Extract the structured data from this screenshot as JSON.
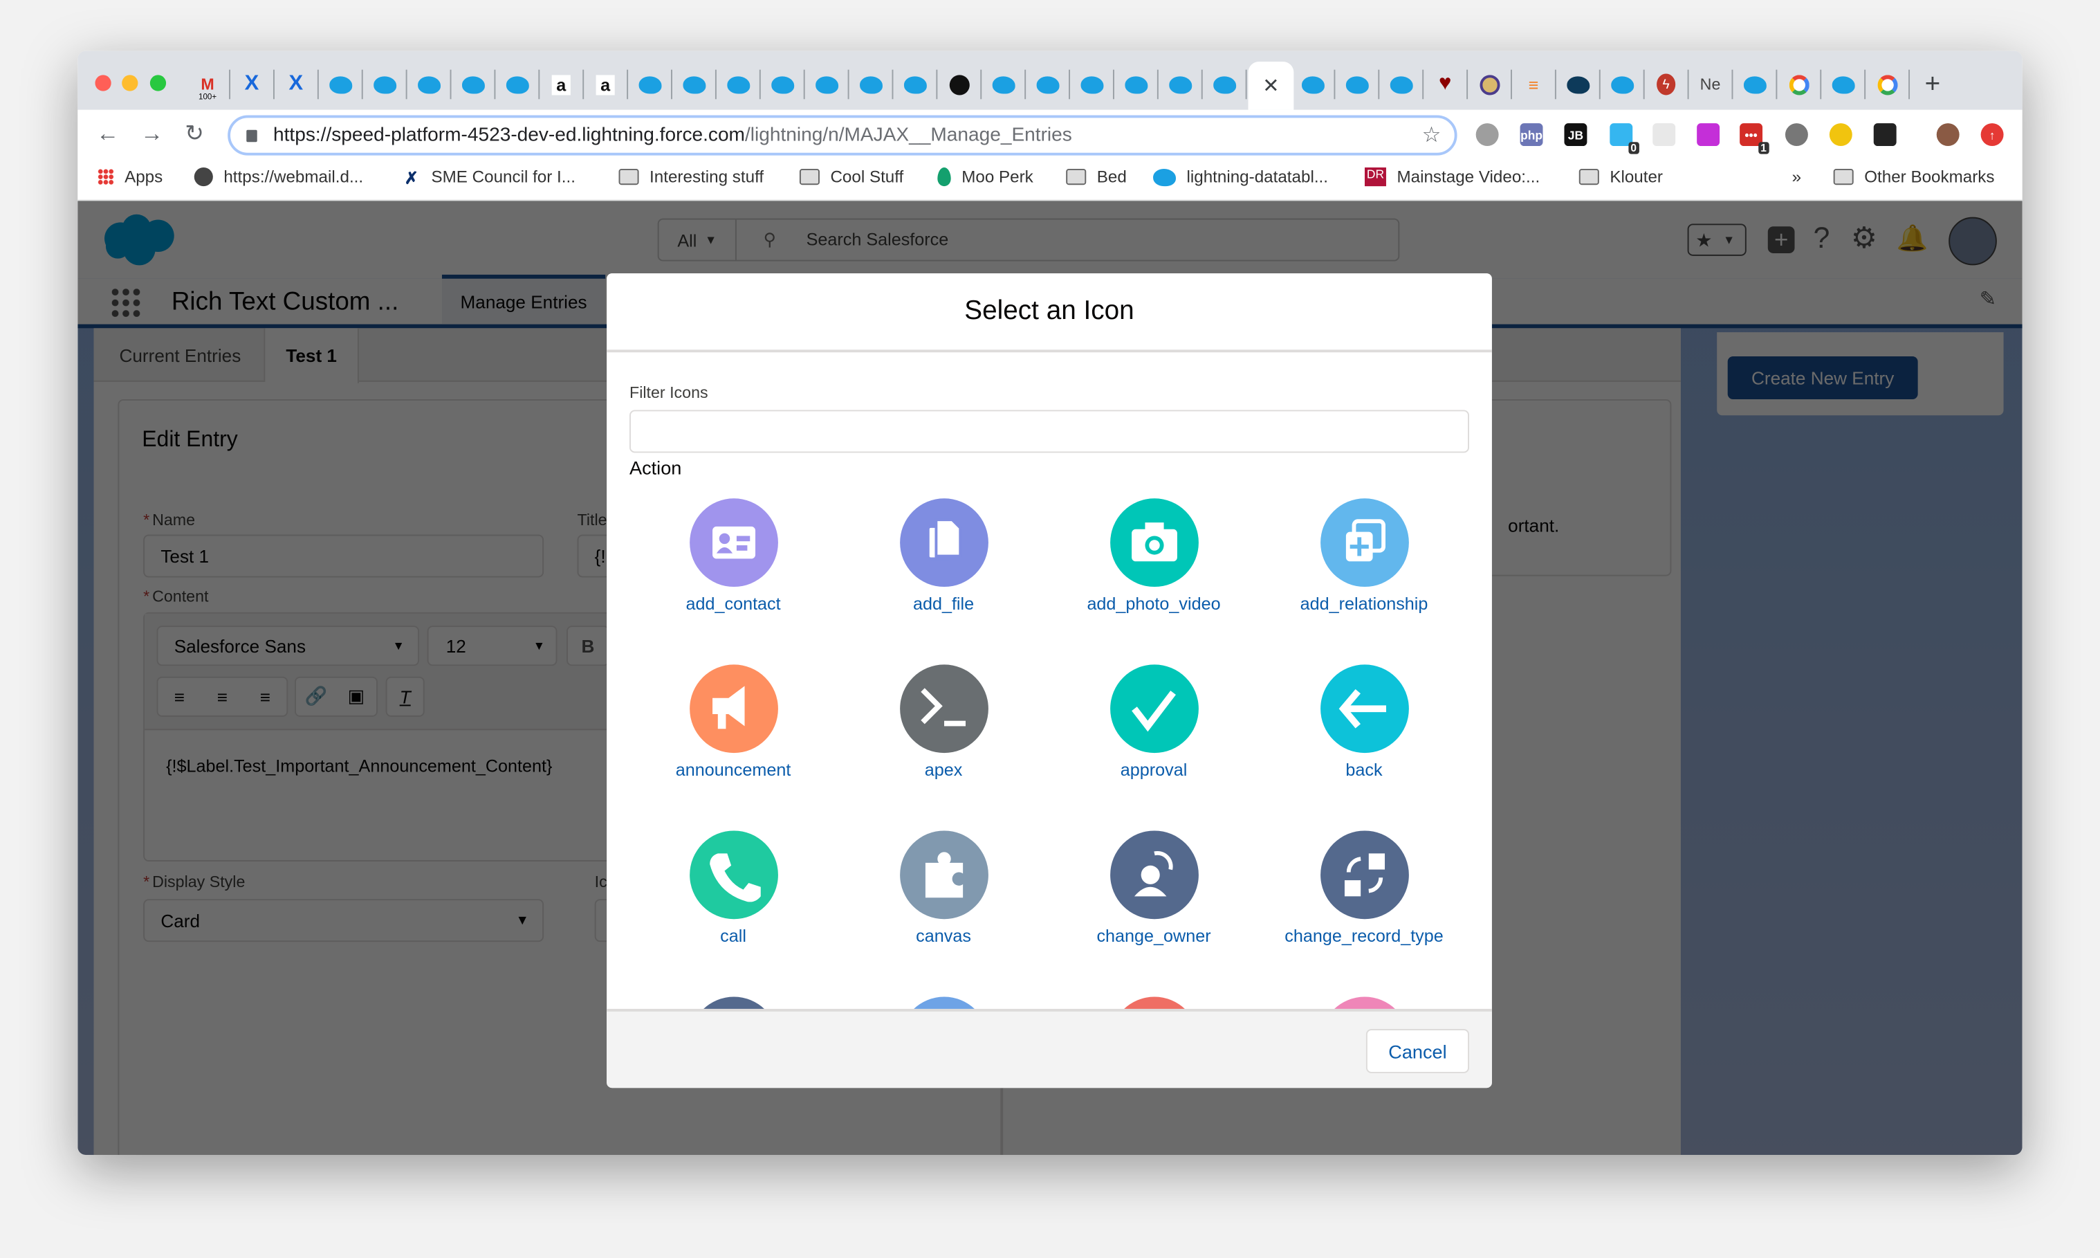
{
  "browser": {
    "tab_favicons": [
      "gmail",
      "confluence",
      "confluence",
      "salesforce-cloud",
      "salesforce-cloud",
      "salesforce-cloud",
      "salesforce-cloud",
      "salesforce-cloud",
      "amazon",
      "amazon",
      "salesforce-cloud",
      "salesforce-cloud",
      "salesforce-cloud",
      "salesforce-cloud",
      "salesforce-cloud",
      "salesforce-cloud",
      "salesforce-cloud",
      "github",
      "salesforce-cloud",
      "salesforce-cloud",
      "salesforce-cloud",
      "salesforce-cloud",
      "salesforce-cloud",
      "salesforce-cloud",
      "active",
      "salesforce-cloud",
      "salesforce-cloud",
      "salesforce-cloud",
      "heart",
      "mandala",
      "stackoverflow",
      "cloud-dark",
      "salesforce-cloud",
      "bolt",
      "ne",
      "salesforce-cloud",
      "google",
      "salesforce-cloud",
      "google"
    ],
    "gmail_badge": "100+",
    "ne_label": "Ne",
    "url_host": "https://speed-platform-4523-dev-ed.lightning.force.com",
    "url_path": "/lightning/n/MAJAX__Manage_Entries",
    "extensions": [
      {
        "icon": "gear",
        "color": "#9e9e9e"
      },
      {
        "icon": "php",
        "color": "#6c76b6",
        "text": "php"
      },
      {
        "icon": "jetbrains",
        "color": "#111111",
        "text": "JB"
      },
      {
        "icon": "ghost",
        "color": "#35b6f0",
        "badge": "0"
      },
      {
        "icon": "react",
        "color": "#e8e8e8"
      },
      {
        "icon": "rss",
        "color": "#c42fd8"
      },
      {
        "icon": "lastpass",
        "color": "#d32d27",
        "text": "•••",
        "badge": "1"
      },
      {
        "icon": "gear-dark",
        "color": "#777777"
      },
      {
        "icon": "target",
        "color": "#f1c40f"
      },
      {
        "icon": "barcode",
        "color": "#222222"
      },
      {
        "icon": "avatar",
        "color": "#8a5a44"
      },
      {
        "icon": "upload",
        "color": "#e53935"
      }
    ],
    "bookmarks": [
      {
        "icon": "apps-grid",
        "label": "Apps"
      },
      {
        "icon": "globe",
        "label": "https://webmail.d..."
      },
      {
        "icon": "sme",
        "label": "SME Council for I..."
      },
      {
        "icon": "folder",
        "label": "Interesting stuff"
      },
      {
        "icon": "folder",
        "label": "Cool Stuff"
      },
      {
        "icon": "drop",
        "label": "Moo Perk"
      },
      {
        "icon": "folder",
        "label": "Bed"
      },
      {
        "icon": "salesforce-cloud",
        "label": "lightning-datatabl..."
      },
      {
        "icon": "dr",
        "label": "Mainstage Video:..."
      },
      {
        "icon": "folder",
        "label": "Klouter"
      }
    ],
    "bookmarks_overflow": "»",
    "other_bookmarks": "Other Bookmarks"
  },
  "salesforce": {
    "search_scope": "All",
    "search_placeholder": "Search Salesforce",
    "app_name": "Rich Text Custom ...",
    "nav_tab": "Manage Entries",
    "tabs": [
      "Current Entries",
      "Test 1"
    ],
    "active_tab": "Test 1",
    "edit_title": "Edit Entry",
    "name_label": "Name",
    "name_value": "Test 1",
    "title_label": "Title",
    "title_value": "{!",
    "content_label": "Content",
    "font_value": "Salesforce Sans",
    "size_value": "12",
    "bold_label": "B",
    "content_text": "{!$Label.Test_Important_Announcement_Content}",
    "display_label": "Display Style",
    "display_value": "Card",
    "icon_label": "Ic",
    "preview_fragment": "ortant.",
    "create_button": "Create New Entry",
    "brand_color": "#1b5297"
  },
  "modal": {
    "title": "Select an Icon",
    "filter_label": "Filter Icons",
    "filter_value": "",
    "section": "Action",
    "icons": [
      {
        "name": "add_contact",
        "color": "#a094ed",
        "glyph": "contact"
      },
      {
        "name": "add_file",
        "color": "#7f8de1",
        "glyph": "file"
      },
      {
        "name": "add_photo_video",
        "color": "#00c6b7",
        "glyph": "camera"
      },
      {
        "name": "add_relationship",
        "color": "#62b7ed",
        "glyph": "relationship"
      },
      {
        "name": "announcement",
        "color": "#fe8f60",
        "glyph": "megaphone"
      },
      {
        "name": "apex",
        "color": "#696e71",
        "glyph": "prompt"
      },
      {
        "name": "approval",
        "color": "#00c6b7",
        "glyph": "check"
      },
      {
        "name": "back",
        "color": "#0dc2d9",
        "glyph": "arrow-left"
      },
      {
        "name": "call",
        "color": "#1fcaa0",
        "glyph": "phone"
      },
      {
        "name": "canvas",
        "color": "#8199af",
        "glyph": "puzzle"
      },
      {
        "name": "change_owner",
        "color": "#54698d",
        "glyph": "owner"
      },
      {
        "name": "change_record_type",
        "color": "#54698d",
        "glyph": "record-type"
      },
      {
        "name": "",
        "color": "#54698d",
        "glyph": ""
      },
      {
        "name": "",
        "color": "#6ea3e6",
        "glyph": ""
      },
      {
        "name": "",
        "color": "#ef6e64",
        "glyph": ""
      },
      {
        "name": "",
        "color": "#ef86b8",
        "glyph": ""
      }
    ],
    "cancel_label": "Cancel"
  }
}
